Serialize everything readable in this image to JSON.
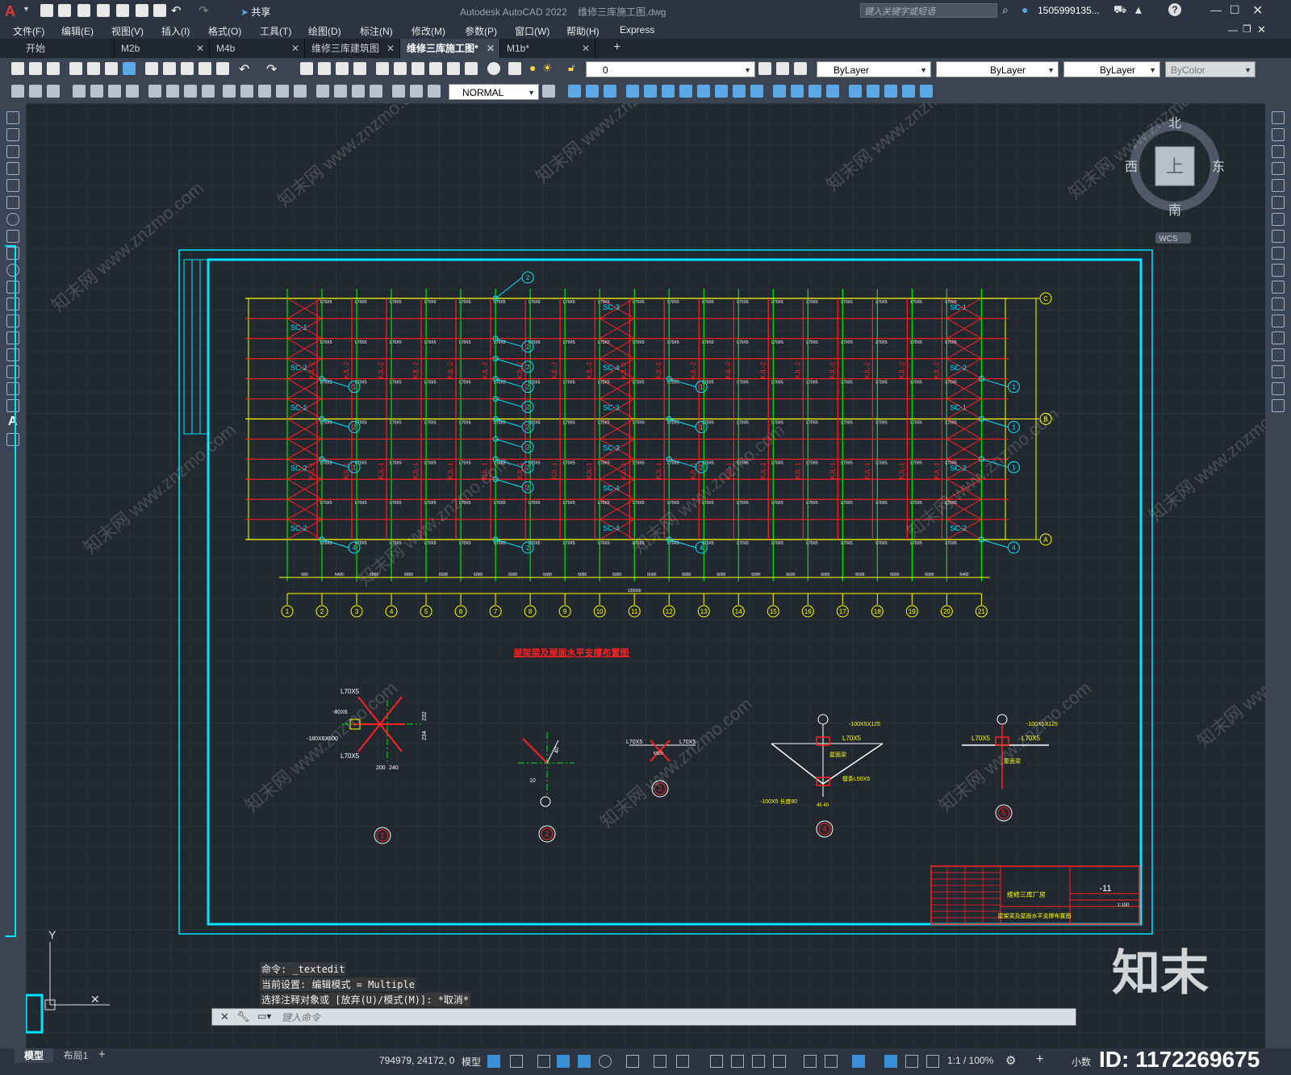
{
  "titlebar": {
    "app_title": "Autodesk AutoCAD 2022",
    "file_name": "维修三库施工图.dwg",
    "search_placeholder": "键入关键字或短语",
    "user": "1505999135...",
    "share_label": "共享"
  },
  "menu": [
    "文件(F)",
    "编辑(E)",
    "视图(V)",
    "插入(I)",
    "格式(O)",
    "工具(T)",
    "绘图(D)",
    "标注(N)",
    "修改(M)",
    "参数(P)",
    "窗口(W)",
    "帮助(H)",
    "Express"
  ],
  "tabs": [
    {
      "label": "开始",
      "active": false
    },
    {
      "label": "M2b",
      "active": false
    },
    {
      "label": "M4b",
      "active": false
    },
    {
      "label": "维修三库建筑图",
      "active": false
    },
    {
      "label": "维修三库施工图*",
      "active": true
    },
    {
      "label": "M1b*",
      "active": false
    }
  ],
  "properties": {
    "layer": "0",
    "color": "ByLayer",
    "linetype": "ByLayer",
    "lineweight": "ByLayer",
    "plotstyle": "ByColor",
    "dimstyle": "NORMAL"
  },
  "viewcube": {
    "north": "北",
    "south": "南",
    "east": "东",
    "west": "西",
    "top": "上",
    "wcs": "WCS"
  },
  "drawing": {
    "plan_title": "屋架梁及屋面水平支撑布置图",
    "axis_numbers": [
      "1",
      "2",
      "3",
      "4",
      "5",
      "6",
      "7",
      "8",
      "9",
      "10",
      "11",
      "12",
      "13",
      "14",
      "15",
      "16",
      "17",
      "18",
      "19",
      "20",
      "21"
    ],
    "axis_letters": [
      "C",
      "B",
      "A"
    ],
    "bay_dims": [
      "600",
      "5400",
      "6000",
      "6000",
      "6000",
      "6000",
      "6000",
      "6000",
      "6000",
      "6000",
      "6000",
      "6000",
      "6000",
      "6000",
      "6000",
      "6000",
      "6000",
      "6000",
      "6000",
      "5400",
      "600"
    ],
    "total_dim": "120000",
    "member_label": "L70X5",
    "brace_labels": [
      "SC-1",
      "SC-2",
      "SC-3",
      "SC-4"
    ],
    "beam_label": "KJL-1",
    "beam_label2": "KJL-2",
    "detail_numbers": [
      "1",
      "2",
      "3",
      "4",
      "5"
    ],
    "detail_texts": {
      "d1_a": "L70X5",
      "d1_b": "L70X5",
      "d1_c": "-80X6",
      "d1_d": "-180X6X600",
      "d1_e": "200",
      "d1_f": "240",
      "d1_g": "232",
      "d1_h": "234",
      "d2_a": "40",
      "d2_b": "10",
      "d3_a": "L70X5",
      "d3_b": "L70X5",
      "d3_c": "M20",
      "d4_a": "-100X5X125",
      "d4_b": "L70X5",
      "d4_c": "屋面梁",
      "d4_d": "檩条L50X5",
      "d4_e": "-100X5 长度80",
      "d4_f": "45 40",
      "d5_a": "-100X5X125",
      "d5_b": "L70X5",
      "d5_c": "L70X5",
      "d5_d": "屋面梁"
    },
    "title_block": {
      "project": "维修三库厂房",
      "sheet_no": "-11",
      "sheet_title": "屋架梁及屋面水平支撑布置图",
      "scale": "1:100"
    }
  },
  "command": {
    "line1": "命令: _textedit",
    "line2": "当前设置: 编辑模式 = Multiple",
    "line3": "选择注释对象或 [放弃(U)/模式(M)]: *取消*",
    "placeholder": "键入命令"
  },
  "status": {
    "model_tab": "模型",
    "layout_tab": "布局1",
    "coords": "794979, 24172, 0",
    "model_label": "模型",
    "scale": "1:1 / 100%",
    "units": "小数"
  },
  "watermark": {
    "brand": "知末",
    "id": "ID: 1172269675",
    "site": "www.znzmo.com",
    "cn": "知末网"
  },
  "colors": {
    "cad_bg": "#212830",
    "cyan": "#00e5ff",
    "red": "#ff2020",
    "green": "#00e600",
    "yellow": "#ffff00",
    "white": "#ffffff"
  }
}
